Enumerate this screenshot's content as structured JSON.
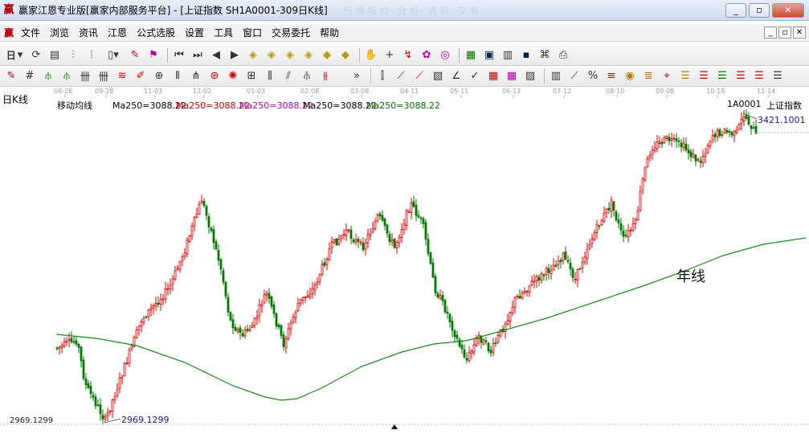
{
  "window": {
    "title": "赢家江恩专业版[赢家内部服务平台] - [上证指数  SH1A0001-309日K线]",
    "ghost_text": "行情报价   分析   资讯   交易"
  },
  "menu": [
    "文件",
    "浏览",
    "资讯",
    "江恩",
    "公式选股",
    "设置",
    "工具",
    "窗口",
    "交易委托",
    "帮助"
  ],
  "toolbar1": {
    "period_label": "日"
  },
  "chart": {
    "panel_label": "日K线",
    "indicator_name": "移动均线",
    "ma_labels": [
      {
        "text": "Ma250=3088.22",
        "color": "#000000"
      },
      {
        "text": "Ma250=3088.22",
        "color": "#c00000"
      },
      {
        "text": "Ma250=3088.22",
        "color": "#c000c0"
      },
      {
        "text": "Ma250=3088.22",
        "color": "#000000"
      },
      {
        "text": "Ma250=3088.22",
        "color": "#007000"
      }
    ],
    "symbol_code": "1A0001",
    "symbol_name": "上证指数",
    "high_label": "3421.1001",
    "low_label": "2969.1299",
    "axis_low": "2969.1299",
    "ma_annotation": "年线",
    "date_ticks": [
      "08-26",
      "09-28",
      "11-03",
      "12-02",
      "01-03",
      "02-08",
      "03-09",
      "04-11",
      "05-11",
      "06-13",
      "07-12",
      "08-10",
      "09-08",
      "10-18",
      "11-14"
    ],
    "up_color": "#d40000",
    "down_color": "#007a00",
    "ma_color": "#1a8a1a"
  },
  "chart_data": {
    "type": "candlestick",
    "candles": 309,
    "price_range": [
      2969.1299,
      3421.1001
    ],
    "ma_period": 250,
    "ma_last": 3088.22
  }
}
